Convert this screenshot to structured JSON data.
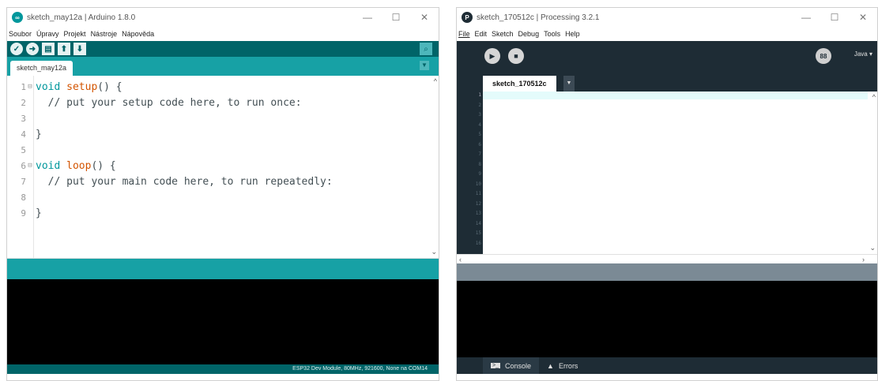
{
  "arduino": {
    "title": "sketch_may12a | Arduino 1.8.0",
    "window_controls": [
      "—",
      "☐",
      "✕"
    ],
    "menu": [
      "Soubor",
      "Úpravy",
      "Projekt",
      "Nástroje",
      "Nápověda"
    ],
    "toolbar_icons": [
      "verify-icon",
      "upload-icon",
      "new-icon",
      "open-icon",
      "save-icon",
      "serial-monitor-icon"
    ],
    "tab": "sketch_may12a",
    "code_lines": [
      {
        "num": "1",
        "fold": "⊟",
        "parts": [
          [
            "kw",
            "void "
          ],
          [
            "fn",
            "setup"
          ],
          [
            "",
            "() {"
          ]
        ]
      },
      {
        "num": "2",
        "fold": "",
        "parts": [
          [
            "cm",
            "  // put your setup code here, to run once:"
          ]
        ]
      },
      {
        "num": "3",
        "fold": "",
        "parts": []
      },
      {
        "num": "4",
        "fold": "",
        "parts": [
          [
            "",
            "}"
          ]
        ]
      },
      {
        "num": "5",
        "fold": "",
        "parts": []
      },
      {
        "num": "6",
        "fold": "⊟",
        "parts": [
          [
            "kw",
            "void "
          ],
          [
            "fn",
            "loop"
          ],
          [
            "",
            "() {"
          ]
        ]
      },
      {
        "num": "7",
        "fold": "",
        "parts": [
          [
            "cm",
            "  // put your main code here, to run repeatedly:"
          ]
        ]
      },
      {
        "num": "8",
        "fold": "",
        "parts": []
      },
      {
        "num": "9",
        "fold": "",
        "parts": [
          [
            "",
            "}"
          ]
        ]
      }
    ],
    "board_status": "ESP32 Dev Module, 80MHz, 921600, None na COM14",
    "colors": {
      "toolbar": "#006468",
      "tabs": "#17a1a5"
    }
  },
  "processing": {
    "title": "sketch_170512c | Processing 3.2.1",
    "window_controls": [
      "—",
      "☐",
      "✕"
    ],
    "menu": [
      "File",
      "Edit",
      "Sketch",
      "Debug",
      "Tools",
      "Help"
    ],
    "mode": "Java ▾",
    "tab": "sketch_170512c",
    "line_numbers": [
      "1",
      "2",
      "3",
      "4",
      "5",
      "6",
      "7",
      "8",
      "9",
      "10",
      "11",
      "12",
      "13",
      "14",
      "15",
      "16"
    ],
    "console_tab": "Console",
    "errors_tab": "Errors",
    "colors": {
      "toolbar": "#1e2c35",
      "status": "#7b8a95"
    }
  }
}
